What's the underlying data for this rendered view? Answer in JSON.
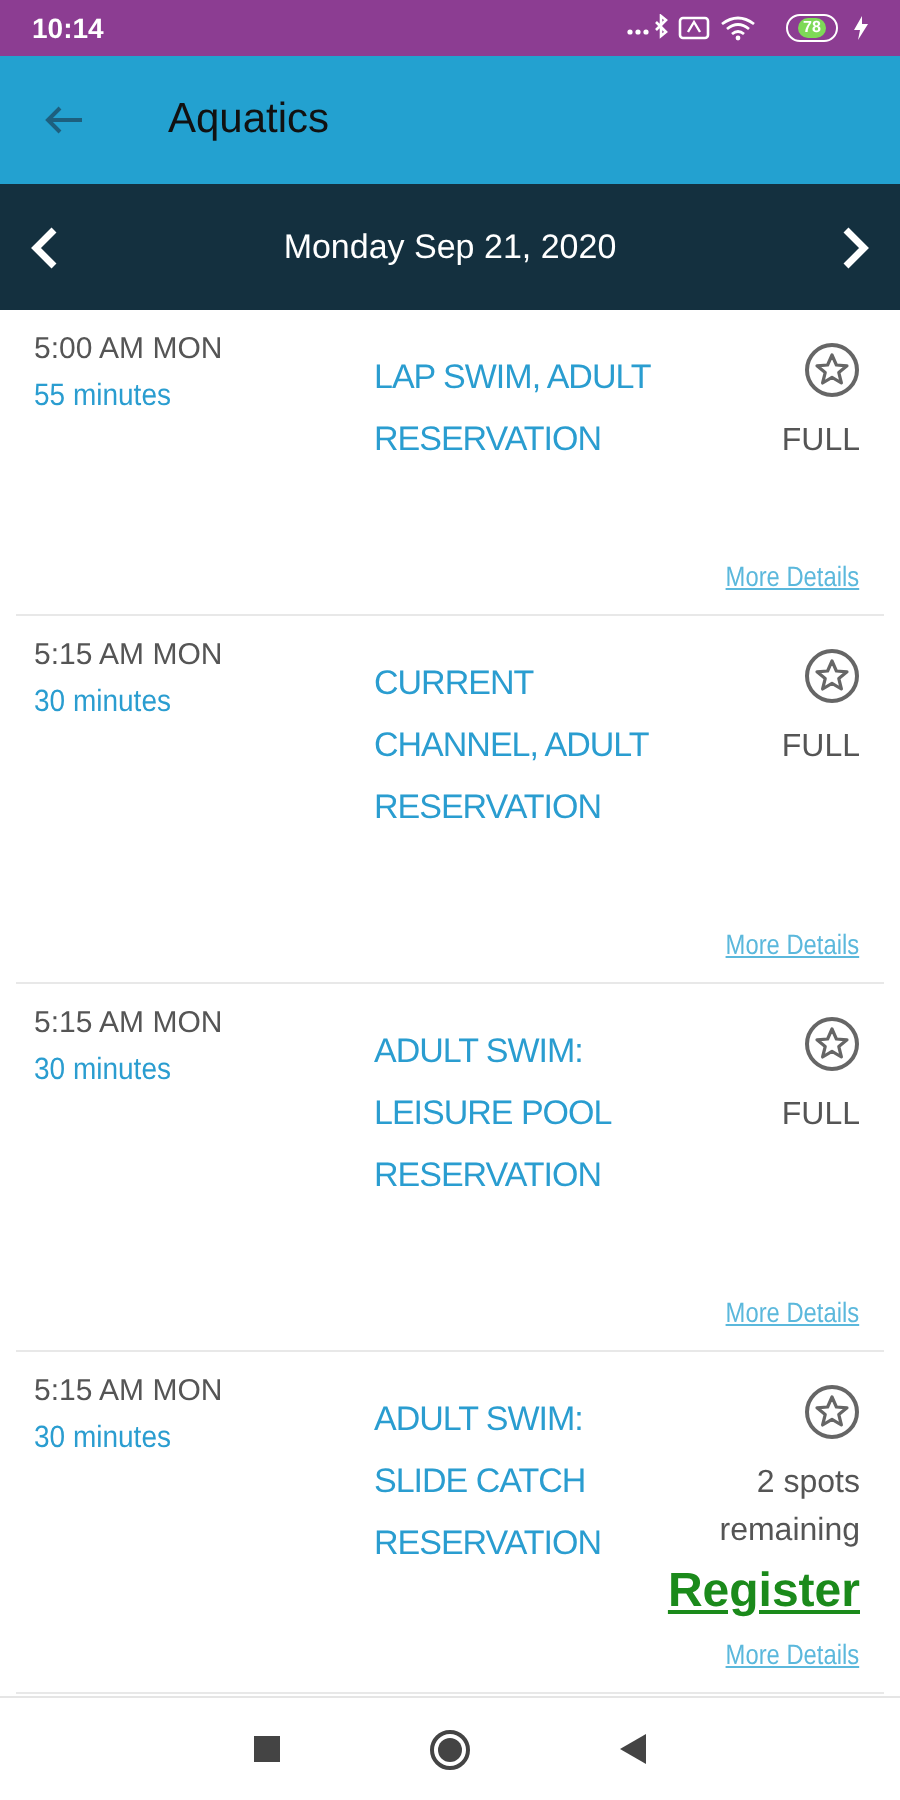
{
  "status_bar": {
    "time": "10:14",
    "battery": "78"
  },
  "app_bar": {
    "title": "Aquatics"
  },
  "date_bar": {
    "date": "Monday Sep 21, 2020"
  },
  "sessions": [
    {
      "time": "5:00 AM MON",
      "duration": "55 minutes",
      "title": "LAP SWIM, ADULT RESERVATION",
      "favorited": false,
      "availability": "FULL",
      "details_link": "More Details"
    },
    {
      "time": "5:15 AM MON",
      "duration": "30 minutes",
      "title": "CURRENT CHANNEL, ADULT RESERVATION",
      "favorited": false,
      "availability": "FULL",
      "details_link": "More Details"
    },
    {
      "time": "5:15 AM MON",
      "duration": "30 minutes",
      "title": "ADULT SWIM: LEISURE POOL RESERVATION",
      "favorited": false,
      "availability": "FULL",
      "details_link": "More Details"
    },
    {
      "time": "5:15 AM MON",
      "duration": "30 minutes",
      "title": "ADULT SWIM: SLIDE CATCH RESERVATION",
      "favorited": false,
      "availability": "2 spots remaining",
      "register_label": "Register",
      "details_link": "More Details"
    }
  ]
}
